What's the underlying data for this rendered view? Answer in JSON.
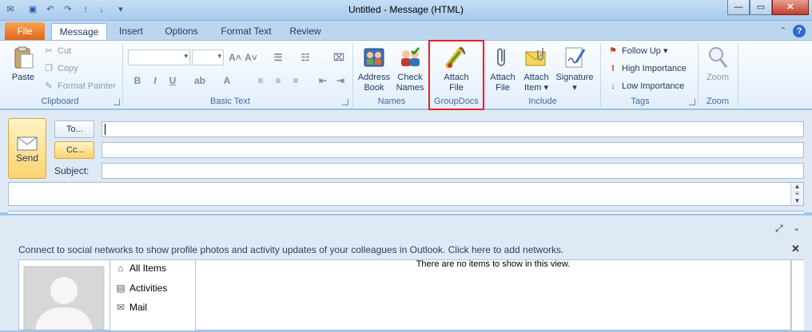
{
  "window": {
    "title": "Untitled  -  Message (HTML)",
    "min_symbol": "—",
    "max_symbol": "▭",
    "close_symbol": "✕"
  },
  "tabs": [
    {
      "label": "File"
    },
    {
      "label": "Message"
    },
    {
      "label": "Insert"
    },
    {
      "label": "Options"
    },
    {
      "label": "Format Text"
    },
    {
      "label": "Review"
    }
  ],
  "help_symbol": "?",
  "ribbon": {
    "clipboard": {
      "paste": "Paste",
      "cut": "Cut",
      "copy": "Copy",
      "format_painter": "Format Painter",
      "group": "Clipboard"
    },
    "basic_text": {
      "group": "Basic Text"
    },
    "names": {
      "address_book_1": "Address",
      "address_book_2": "Book",
      "check_names_1": "Check",
      "check_names_2": "Names",
      "group": "Names"
    },
    "groupdocs": {
      "attach_1": "Attach",
      "attach_2": "File",
      "group": "GroupDocs"
    },
    "include": {
      "attach_file_1": "Attach",
      "attach_file_2": "File",
      "attach_item_1": "Attach",
      "attach_item_2": "Item ▾",
      "signature_1": "Signature",
      "signature_2": "▾",
      "group": "Include"
    },
    "tags": {
      "follow_up": "Follow Up ▾",
      "high_importance": "High Importance",
      "low_importance": "Low Importance",
      "group": "Tags"
    },
    "zoom": {
      "label": "Zoom",
      "group": "Zoom"
    }
  },
  "compose": {
    "send": "Send",
    "to": "To...",
    "cc": "Cc...",
    "subject": "Subject:"
  },
  "people_pane": {
    "message": "Connect to social networks to show profile photos and activity updates of your colleagues in Outlook. Click here to add networks.",
    "nav": [
      "All Items",
      "Activities",
      "Mail"
    ],
    "empty": "There are no items to show in this view."
  },
  "colors": {
    "highlight": "#e8202a",
    "file_tab": "#e0641a"
  }
}
